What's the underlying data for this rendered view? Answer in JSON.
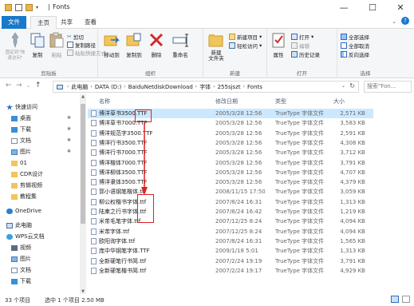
{
  "window": {
    "title": "Fonts",
    "minimize": "—",
    "maximize": "☐",
    "close": "✕"
  },
  "ribbon_tabs": [
    "文件",
    "主页",
    "共享",
    "查看"
  ],
  "ribbon": {
    "clipboard": {
      "pin_label": "固定到\"快速访问\"",
      "copy_label": "复制",
      "paste_label": "粘贴",
      "cut_label": "剪切",
      "copy_path_label": "复制路径",
      "paste_shortcut_label": "粘贴快捷方式",
      "group_label": "剪贴板"
    },
    "organize": {
      "move_to_label": "移动到",
      "copy_to_label": "复制到",
      "delete_label": "删除",
      "rename_label": "重命名",
      "group_label": "组织"
    },
    "new": {
      "new_folder_label": "新建\n文件夹",
      "new_item_label": "新建项目",
      "easy_access_label": "轻松访问",
      "group_label": "新建"
    },
    "open": {
      "properties_label": "属性",
      "open_label": "打开",
      "edit_label": "编辑",
      "history_label": "历史记录",
      "group_label": "打开"
    },
    "select": {
      "select_all_label": "全部选择",
      "select_none_label": "全部取消",
      "invert_label": "反向选择",
      "group_label": "选择"
    }
  },
  "address": {
    "breadcrumbs": [
      "此电脑",
      "DATA (D:)",
      "BaiduNetdiskDownload",
      "字体",
      "255sjszt",
      "Fonts"
    ],
    "search_placeholder": "搜索\"Fon...",
    "back": "←",
    "forward": "→",
    "up": "↑",
    "recent": "⌄",
    "refresh": "↻"
  },
  "nav_pane": {
    "items": [
      {
        "label": "快速访问",
        "icon": "star-icon",
        "pinned": false
      },
      {
        "label": "桌面",
        "icon": "folder-icon",
        "pinned": true
      },
      {
        "label": "下载",
        "icon": "download-icon",
        "pinned": true
      },
      {
        "label": "文档",
        "icon": "document-icon",
        "pinned": true
      },
      {
        "label": "图片",
        "icon": "picture-icon",
        "pinned": true
      },
      {
        "label": "01",
        "icon": "folder-icon",
        "pinned": false
      },
      {
        "label": "CDR设计",
        "icon": "folder-icon",
        "pinned": false
      },
      {
        "label": "剪辑视频",
        "icon": "folder-icon",
        "pinned": false
      },
      {
        "label": "教程集",
        "icon": "folder-icon",
        "pinned": false
      },
      {
        "label": "OneDrive",
        "icon": "cloud-icon",
        "pinned": false
      },
      {
        "label": "此电脑",
        "icon": "computer-icon",
        "pinned": false
      },
      {
        "label": "WPS云文档",
        "icon": "cloud-icon",
        "pinned": false
      },
      {
        "label": "视频",
        "icon": "video-icon",
        "pinned": false
      },
      {
        "label": "图片",
        "icon": "picture-icon",
        "pinned": false
      },
      {
        "label": "文档",
        "icon": "document-icon",
        "pinned": false
      },
      {
        "label": "下载",
        "icon": "download-icon",
        "pinned": false
      }
    ],
    "pin_glyph": "✱"
  },
  "columns": {
    "name": "名称",
    "date": "修改日期",
    "type": "类型",
    "size": "大小"
  },
  "files": [
    {
      "name": "博洋草书3500.TTF",
      "date": "2005/3/28 12:56",
      "type": "TrueType 字体文件",
      "size": "2,571 KB",
      "selected": true
    },
    {
      "name": "博洋草书7000.TTF",
      "date": "2005/3/28 12:56",
      "type": "TrueType 字体文件",
      "size": "3,583 KB"
    },
    {
      "name": "博洋规范字3500.TTF",
      "date": "2005/3/28 12:56",
      "type": "TrueType 字体文件",
      "size": "2,591 KB"
    },
    {
      "name": "博洋行书3500.TTF",
      "date": "2005/3/28 12:56",
      "type": "TrueType 字体文件",
      "size": "4,308 KB"
    },
    {
      "name": "博洋行书7000.TTF",
      "date": "2005/3/28 12:56",
      "type": "TrueType 字体文件",
      "size": "3,712 KB"
    },
    {
      "name": "博洋楷体7000.TTF",
      "date": "2005/3/28 12:56",
      "type": "TrueType 字体文件",
      "size": "3,791 KB"
    },
    {
      "name": "博洋柳体3500.TTF",
      "date": "2005/3/28 12:56",
      "type": "TrueType 字体文件",
      "size": "4,707 KB"
    },
    {
      "name": "博洋隶体3500.TTF",
      "date": "2005/3/28 12:56",
      "type": "TrueType 字体文件",
      "size": "4,379 KB"
    },
    {
      "name": "郭小语钢笔楷体.ttf",
      "date": "2008/11/15 17:50",
      "type": "TrueType 字体文件",
      "size": "3,059 KB"
    },
    {
      "name": "柳公权楷书字体.ttf",
      "date": "2007/8/24 16:31",
      "type": "TrueType 字体文件",
      "size": "1,313 KB"
    },
    {
      "name": "陆柬之行书字体.ttf",
      "date": "2007/8/24 16:42",
      "type": "TrueType 字体文件",
      "size": "1,219 KB"
    },
    {
      "name": "米芾毛笔字体.ttf",
      "date": "2007/12/25 8:24",
      "type": "TrueType 字体文件",
      "size": "4,094 KB"
    },
    {
      "name": "米芾字体.ttf",
      "date": "2007/12/25 8:24",
      "type": "TrueType 字体文件",
      "size": "4,094 KB"
    },
    {
      "name": "欧阳询字体.ttf",
      "date": "2007/8/24 16:31",
      "type": "TrueType 字体文件",
      "size": "1,565 KB"
    },
    {
      "name": "庞中华钢笔字体.TTF",
      "date": "2009/1/18 5:01",
      "type": "TrueType 字体文件",
      "size": "1,313 KB"
    },
    {
      "name": "全新硬笔行书简.ttf",
      "date": "2007/2/24 19:19",
      "type": "TrueType 字体文件",
      "size": "3,791 KB"
    },
    {
      "name": "全新硬笔楷书简.ttf",
      "date": "2007/2/24 19:17",
      "type": "TrueType 字体文件",
      "size": "4,929 KB"
    }
  ],
  "status": {
    "item_count": "33 个项目",
    "selected": "选中 1 个项目  2.50 MB"
  },
  "colors": {
    "accent": "#1979ca",
    "selection": "#cce8ff",
    "annotation": "#e02020"
  }
}
